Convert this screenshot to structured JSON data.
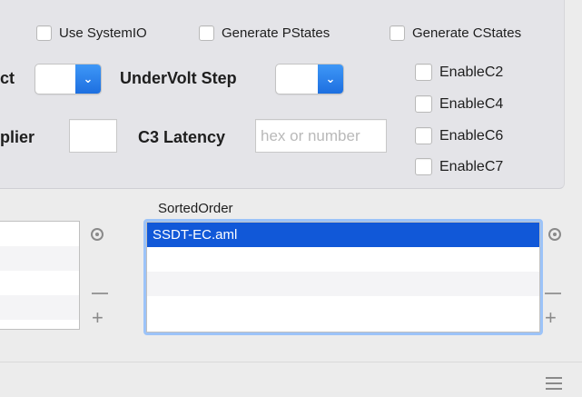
{
  "options": {
    "use_systemio": "Use SystemIO",
    "generate_pstates": "Generate PStates",
    "generate_cstates": "Generate CStates"
  },
  "cstates": {
    "c2": "EnableC2",
    "c4": "EnableC4",
    "c6": "EnableC6",
    "c7": "EnableC7"
  },
  "fields": {
    "select_label_partial": "ct",
    "undervolt_label": "UnderVolt Step",
    "multiplier_label_partial": "plier",
    "c3_latency_label": "C3 Latency",
    "c3_latency_placeholder": "hex or number"
  },
  "sorted": {
    "title": "SortedOrder",
    "items": [
      "SSDT-EC.aml"
    ]
  },
  "icons": {
    "gear": "gear-icon",
    "plus": "plus-icon",
    "minus": "minus-icon",
    "menu": "hamburger-menu-icon"
  },
  "colors": {
    "accent": "#1158d8",
    "popup_arrow": "#2a83f0"
  }
}
